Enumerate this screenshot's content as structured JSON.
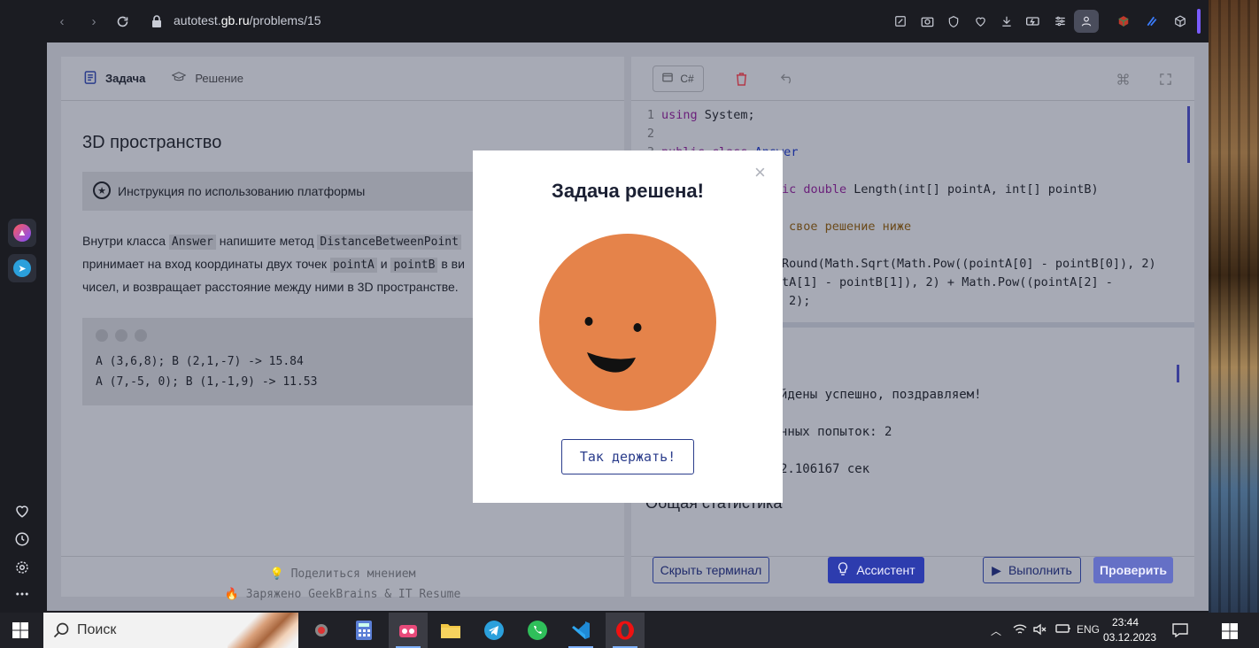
{
  "browser": {
    "url_prefix": "autotest.",
    "url_domain": "gb.ru",
    "url_path": "/problems/15"
  },
  "left": {
    "tabs": [
      {
        "label": "Задача",
        "active": true
      },
      {
        "label": "Решение",
        "active": false
      }
    ],
    "problem_title": "3D пространство",
    "instruction": "Инструкция по использованию платформы",
    "desc": {
      "t1": "Внутри класса ",
      "c1": "Answer",
      "t2": " напишите метод ",
      "c2": "DistanceBetweenPoint",
      "t3": "принимает на вход координаты двух точек ",
      "c3": "pointA",
      "t4": " и ",
      "c4": "pointB",
      "t5": " в ви",
      "t6": "чисел, и возвращает расстояние между ними в 3D пространстве."
    },
    "examples": [
      "A (3,6,8); B (2,1,-7) -> 15.84",
      "A (7,-5, 0); B (1,-1,9) -> 11.53"
    ],
    "share": "Поделиться мнением",
    "powered": "Заряжено GeekBrains & IT Resume"
  },
  "right": {
    "lang": "C#",
    "code": {
      "l1_num": "1",
      "l1_kw": "using",
      "l1_rest": " System;",
      "l2_num": "2",
      "l3_num": "3",
      "l3_kw": "public class",
      "l3_ty": " Answer",
      "l4_kw": "ic double",
      "l4_rest": " Length(int[] pointA, int[] pointB)",
      "l5_cm": "свое решение ниже",
      "l6": "Round(Math.Sqrt(Math.Pow((pointA[0] - pointB[0]), 2)",
      "l7": "tA[1] - pointB[1]), 2) + Math.Pow((pointA[2] -",
      "l8": "2);"
    },
    "terminal": {
      "line1": "йдены успешно, поздравляем!",
      "line2": "нных попыток: 2",
      "line3": "2.106167 сек",
      "stats": "Общая статистика"
    },
    "buttons": {
      "hide_terminal": "Скрыть терминал",
      "assistant": "Ассистент",
      "run": "Выполнить",
      "check": "Проверить"
    }
  },
  "modal": {
    "title": "Задача решена!",
    "button": "Так держать!"
  },
  "taskbar": {
    "search": "Поиск",
    "lang": "ENG",
    "time": "23:44",
    "date": "03.12.2023"
  },
  "colors": {
    "accent": "#2d3cae",
    "face": "#e5834a"
  }
}
